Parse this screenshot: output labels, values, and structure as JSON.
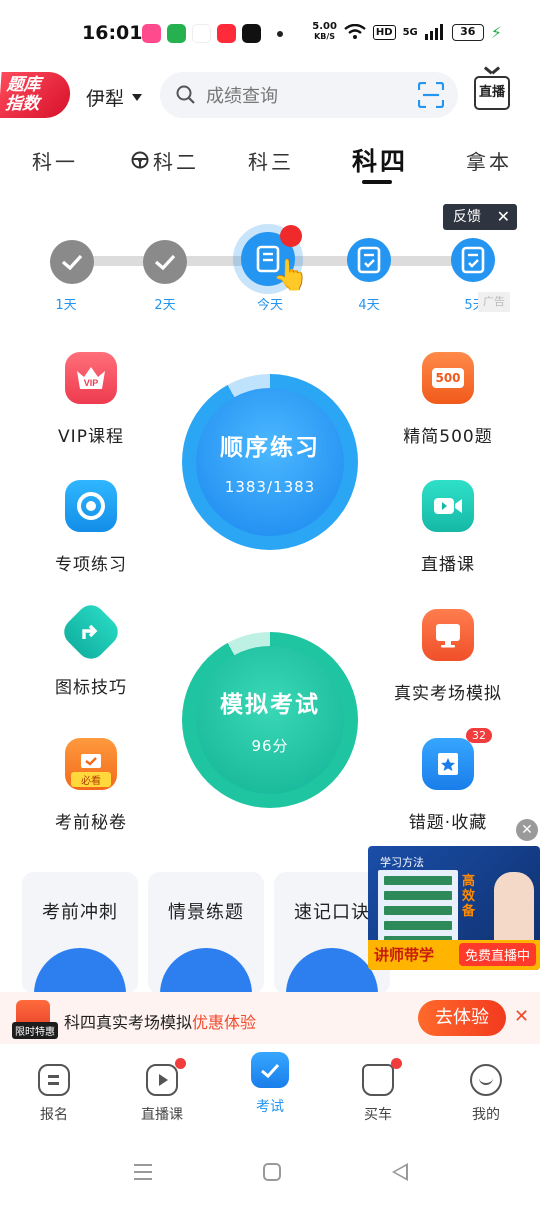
{
  "status": {
    "time": "16:01",
    "speed_value": "5.00",
    "speed_unit": "KB/S",
    "hd": "HD",
    "network": "5G",
    "battery": "36"
  },
  "header": {
    "badge_line1": "题库",
    "badge_line2": "指数",
    "city": "伊犁",
    "search_placeholder": "成绩查询",
    "live_label": "直播"
  },
  "tabs": [
    "科一",
    "科二",
    "科三",
    "科四",
    "拿本"
  ],
  "active_tab": "科四",
  "feedback": "反馈",
  "days": [
    "1天",
    "2天",
    "今天",
    "4天",
    "5天"
  ],
  "side_tag": "广告",
  "items": {
    "vip": "VIP课程",
    "jingjian": "精简500题",
    "jingjian_icon_text": "500",
    "zhuanxiang": "专项练习",
    "zhibo": "直播课",
    "tubiao": "图标技巧",
    "zhenshi": "真实考场模拟",
    "miquan": "考前秘卷",
    "miquan_tag": "必看",
    "cuoti": "错题·收藏",
    "cuoti_badge": "32"
  },
  "practice": {
    "title": "顺序练习",
    "progress": "1383/1383"
  },
  "mock": {
    "title": "模拟考试",
    "score": "96分"
  },
  "cards": [
    "考前冲刺",
    "情景练题",
    "速记口诀"
  ],
  "promo": {
    "title": "学习方法",
    "side_text": "高效备",
    "left_label": "讲师带学",
    "right_label": "免费直播中"
  },
  "banner": {
    "tag": "限时特惠",
    "text": "科四真实考场模拟",
    "highlight": "优惠体验",
    "button": "去体验"
  },
  "bottom_nav": [
    "报名",
    "直播课",
    "考试",
    "买车",
    "我的"
  ],
  "colors": {
    "accent": "#2495f0",
    "green": "#1fc5a0",
    "red": "#f03c3c",
    "orange": "#ff6a2b"
  }
}
